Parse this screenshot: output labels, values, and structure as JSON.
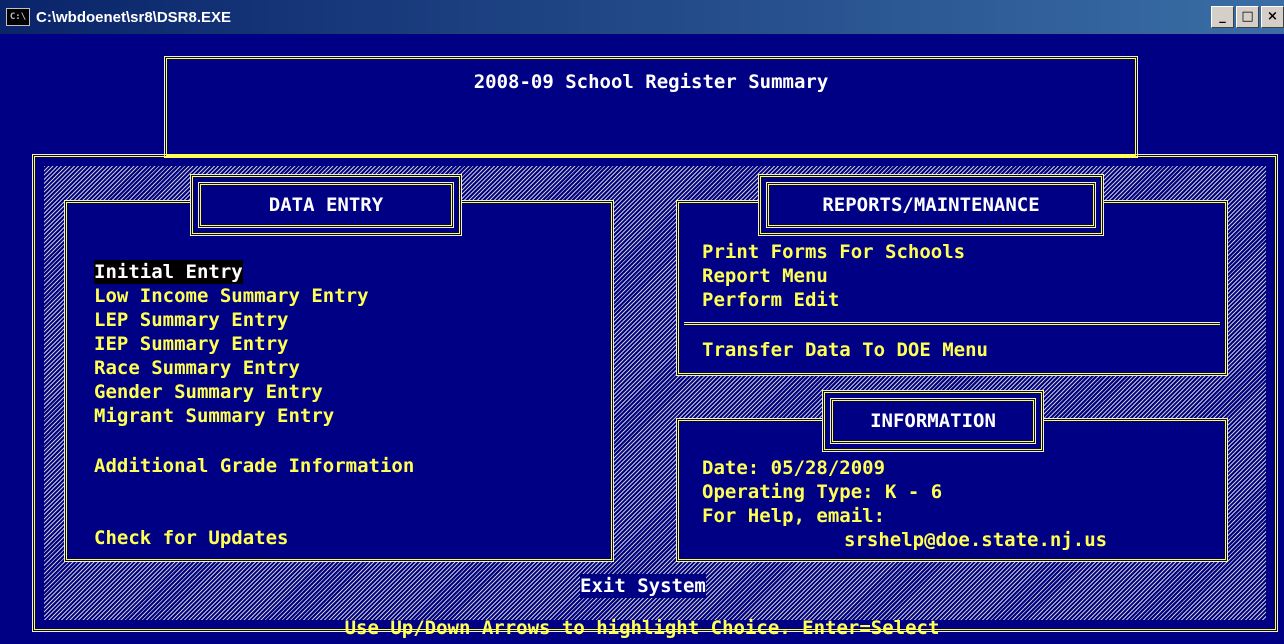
{
  "window": {
    "title": "C:\\wbdoenet\\sr8\\DSR8.EXE",
    "icon": "cmd-icon",
    "controls": [
      "minimize",
      "maximize",
      "close"
    ]
  },
  "header": {
    "title": "2008-09 School Register Summary"
  },
  "data_entry": {
    "heading": "DATA ENTRY",
    "items": [
      {
        "label": "Initial Entry",
        "selected": true
      },
      {
        "label": "Low Income Summary Entry"
      },
      {
        "label": "LEP Summary Entry"
      },
      {
        "label": "IEP Summary Entry"
      },
      {
        "label": "Race Summary Entry"
      },
      {
        "label": "Gender Summary Entry"
      },
      {
        "label": "Migrant Summary Entry"
      },
      {
        "label": "Additional Grade Information"
      },
      {
        "label": "Check for Updates"
      }
    ]
  },
  "reports": {
    "heading": "REPORTS/MAINTENANCE",
    "items": [
      {
        "label": "Print Forms For Schools"
      },
      {
        "label": "Report Menu"
      },
      {
        "label": "Perform Edit"
      },
      {
        "label": "Transfer Data To DOE Menu"
      }
    ]
  },
  "information": {
    "heading": "INFORMATION",
    "date": "Date: 05/28/2009",
    "operating_type": "Operating Type: K - 6",
    "help": "For Help, email:",
    "email": "srshelp@doe.state.nj.us"
  },
  "exit": {
    "label": "Exit System"
  },
  "status": {
    "text": "Use Up/Down Arrows to highlight Choice. Enter=Select"
  },
  "colors": {
    "background": "#000084",
    "border": "#ffff54",
    "menu_text": "#ffff54",
    "highlight_bg": "#000000",
    "highlight_text": "#ffffff"
  }
}
